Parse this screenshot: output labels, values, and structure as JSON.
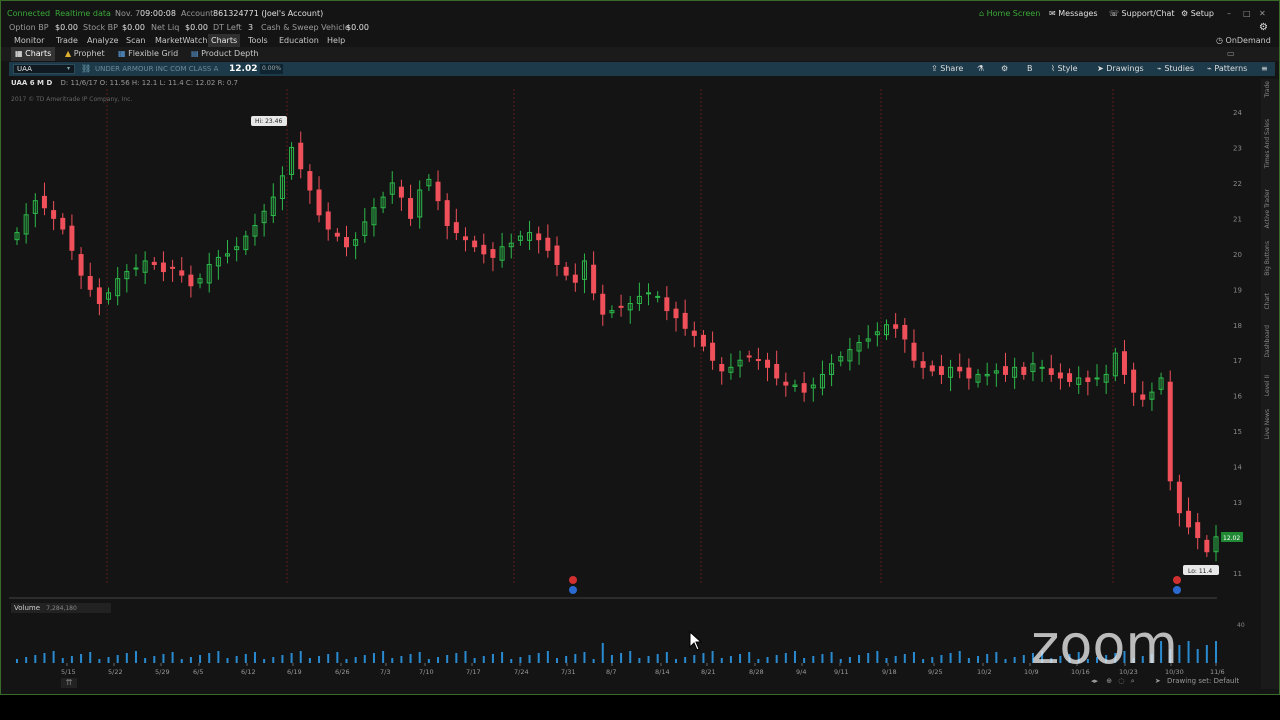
{
  "status": {
    "connected": "Connected",
    "realtime": "Realtime data",
    "date": "Nov. 7",
    "time": "09:00:08",
    "account_label": "Account:",
    "account_value": "861324771 (Joel's Account)",
    "home_screen": "Home Screen",
    "messages": "Messages",
    "support": "Support/Chat",
    "setup": "Setup"
  },
  "balances": {
    "option_bp_label": "Option BP",
    "option_bp": "$0.00",
    "stock_bp_label": "Stock BP",
    "stock_bp": "$0.00",
    "net_liq_label": "Net Liq",
    "net_liq": "$0.00",
    "dt_left_label": "DT Left",
    "dt_left": "3",
    "cash_label": "Cash & Sweep Vehicle",
    "cash": "$0.00"
  },
  "menu": {
    "items": [
      "Monitor",
      "Trade",
      "Analyze",
      "Scan",
      "MarketWatch",
      "Charts",
      "Tools",
      "Education",
      "Help"
    ],
    "ondemand": "OnDemand"
  },
  "subtabs": [
    "Charts",
    "Prophet",
    "Flexible Grid",
    "Product Depth"
  ],
  "chartbar": {
    "symbol": "UAA",
    "company": "UNDER ARMOUR INC COM CLASS A",
    "price": "12.02",
    "change": "0.00%",
    "share": "Share",
    "drawings": "Drawings",
    "studies": "Studies",
    "patterns": "Patterns",
    "style": "Style",
    "b": "B"
  },
  "info": {
    "title": "UAA 6 M D",
    "ohlc": "D: 11/6/17   O: 11.56   H: 12.1   L: 11.4   C: 12.02   R: 0.7",
    "copyright": "2017 © TD Ameritrade IP Company, Inc."
  },
  "right_panel": [
    "Trade",
    "Times And Sales",
    "Active Trader",
    "Big Buttons",
    "Chart",
    "Dashboard",
    "Level II",
    "Live News"
  ],
  "volume": {
    "label": "Volume",
    "value": "7,284,180"
  },
  "bottom": {
    "drawing_set": "Drawing set: Default"
  },
  "watermark": "zoom",
  "colors": {
    "up": "#2db84a",
    "down": "#f0505a",
    "volume": "#2a8ad0",
    "price_tag": "#1f8a33"
  },
  "chart_data": {
    "type": "candlestick",
    "y_ticks": [
      11,
      12,
      13,
      14,
      15,
      16,
      17,
      18,
      19,
      20,
      21,
      22,
      23,
      24
    ],
    "x_ticks": [
      "5/15",
      "5/22",
      "5/29",
      "6/5",
      "6/12",
      "6/19",
      "6/26",
      "7/3",
      "7/10",
      "7/17",
      "7/24",
      "7/31",
      "8/7",
      "8/14",
      "8/21",
      "8/28",
      "9/4",
      "9/11",
      "9/18",
      "9/25",
      "10/2",
      "10/9",
      "10/16",
      "10/23",
      "10/30",
      "11/6"
    ],
    "hi_label": "Hi: 23.46",
    "lo_label": "Lo: 11.4",
    "last_price_tag": "12.02",
    "volume_axis": "40",
    "closes": [
      20.6,
      21.1,
      21.5,
      21.3,
      21.0,
      20.7,
      20.1,
      19.4,
      19.0,
      18.6,
      18.9,
      19.3,
      19.5,
      19.6,
      19.8,
      19.7,
      19.5,
      19.6,
      19.4,
      19.1,
      19.3,
      19.7,
      19.9,
      20.0,
      20.2,
      20.5,
      20.8,
      21.2,
      21.6,
      22.2,
      23.0,
      22.4,
      21.8,
      21.1,
      20.7,
      20.5,
      20.2,
      20.4,
      20.9,
      21.3,
      21.6,
      22.0,
      21.6,
      21.0,
      21.8,
      22.1,
      21.5,
      20.8,
      20.6,
      20.4,
      20.2,
      20.0,
      19.9,
      20.2,
      20.3,
      20.5,
      20.6,
      20.4,
      20.1,
      19.7,
      19.4,
      19.2,
      19.8,
      18.9,
      18.3,
      18.4,
      18.5,
      18.6,
      18.8,
      18.9,
      18.8,
      18.4,
      18.2,
      17.9,
      17.7,
      17.4,
      17.0,
      16.7,
      16.8,
      17.0,
      17.1,
      17.0,
      16.8,
      16.5,
      16.3,
      16.3,
      16.1,
      16.3,
      16.6,
      16.9,
      17.1,
      17.3,
      17.5,
      17.6,
      17.8,
      18.0,
      17.9,
      17.6,
      17.0,
      16.8,
      16.7,
      16.6,
      16.8,
      16.7,
      16.5,
      16.6,
      16.6,
      16.7,
      16.6,
      16.8,
      16.6,
      16.9,
      16.8,
      16.6,
      16.5,
      16.4,
      16.5,
      16.4,
      16.5,
      16.6,
      17.2,
      16.6,
      16.1,
      15.9,
      16.1,
      16.5,
      13.6,
      12.7,
      12.3,
      12.0,
      11.6,
      12.02
    ]
  }
}
